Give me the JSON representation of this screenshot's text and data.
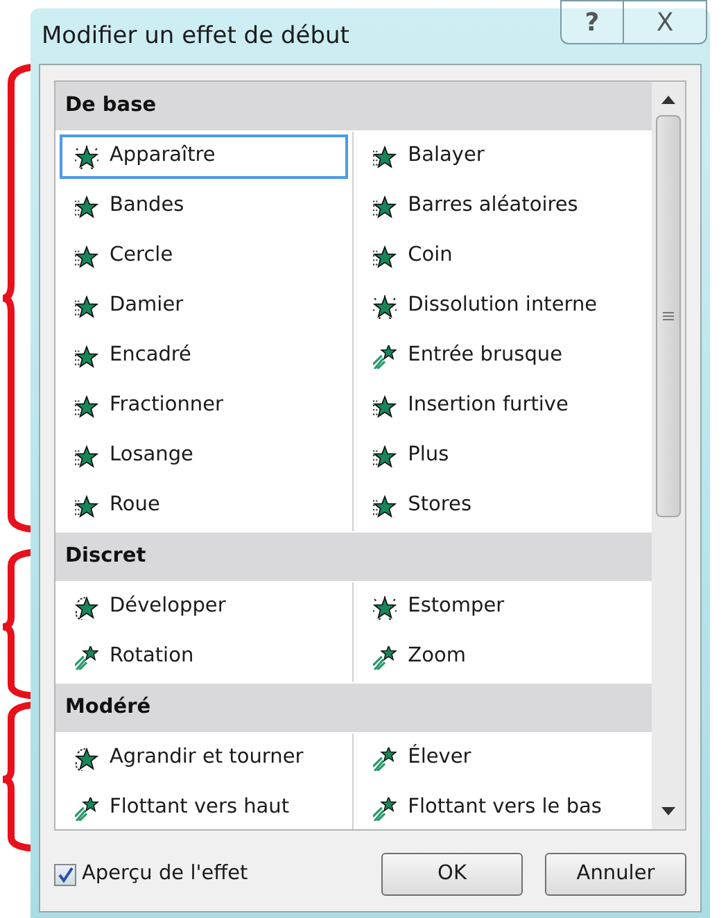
{
  "window": {
    "title": "Modifier un effet de début",
    "help_button": "?",
    "close_button": "X"
  },
  "sections": [
    {
      "title": "De base",
      "items": [
        {
          "label": "Apparaître",
          "kind": "plain",
          "selected": true
        },
        {
          "label": "Balayer",
          "kind": "stripes",
          "selected": false
        },
        {
          "label": "Bandes",
          "kind": "stripes",
          "selected": false
        },
        {
          "label": "Barres aléatoires",
          "kind": "stripes",
          "selected": false
        },
        {
          "label": "Cercle",
          "kind": "stripes",
          "selected": false
        },
        {
          "label": "Coin",
          "kind": "stripes",
          "selected": false
        },
        {
          "label": "Damier",
          "kind": "stripes",
          "selected": false
        },
        {
          "label": "Dissolution interne",
          "kind": "plain",
          "selected": false
        },
        {
          "label": "Encadré",
          "kind": "stripes",
          "selected": false
        },
        {
          "label": "Entrée brusque",
          "kind": "trail",
          "selected": false
        },
        {
          "label": "Fractionner",
          "kind": "stripes",
          "selected": false
        },
        {
          "label": "Insertion furtive",
          "kind": "stripes",
          "selected": false
        },
        {
          "label": "Losange",
          "kind": "stripes",
          "selected": false
        },
        {
          "label": "Plus",
          "kind": "stripes",
          "selected": false
        },
        {
          "label": "Roue",
          "kind": "stripes",
          "selected": false
        },
        {
          "label": "Stores",
          "kind": "stripes",
          "selected": false
        }
      ]
    },
    {
      "title": "Discret",
      "items": [
        {
          "label": "Développer",
          "kind": "spin",
          "selected": false
        },
        {
          "label": "Estomper",
          "kind": "plain",
          "selected": false
        },
        {
          "label": "Rotation",
          "kind": "trail",
          "selected": false
        },
        {
          "label": "Zoom",
          "kind": "trail",
          "selected": false
        }
      ]
    },
    {
      "title": "Modéré",
      "items": [
        {
          "label": "Agrandir et tourner",
          "kind": "spin",
          "selected": false
        },
        {
          "label": "Élever",
          "kind": "trail",
          "selected": false
        },
        {
          "label": "Flottant vers haut",
          "kind": "trail",
          "selected": false
        },
        {
          "label": "Flottant vers le bas",
          "kind": "trail",
          "selected": false
        }
      ]
    }
  ],
  "preview": {
    "label": "Aperçu de l'effet",
    "checked": true
  },
  "buttons": [
    "OK",
    "Annuler"
  ]
}
